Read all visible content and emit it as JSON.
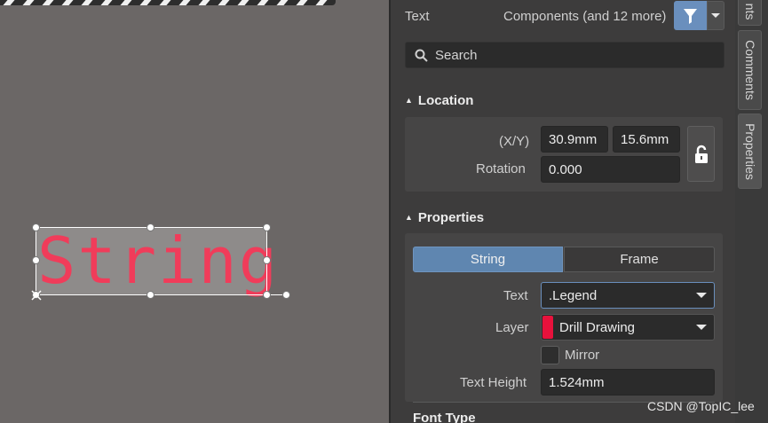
{
  "canvas": {
    "object_text": "String"
  },
  "panel": {
    "header_left": "Text",
    "header_filter": "Components (and 12 more)",
    "search_placeholder": "Search",
    "location": {
      "title": "Location",
      "xy_label": "(X/Y)",
      "x_value": "30.9mm",
      "y_value": "15.6mm",
      "rotation_label": "Rotation",
      "rotation_value": "0.000"
    },
    "properties": {
      "title": "Properties",
      "tab_string": "String",
      "tab_frame": "Frame",
      "text_label": "Text",
      "text_value": ".Legend",
      "layer_label": "Layer",
      "layer_value": "Drill Drawing",
      "layer_color": "#e8123c",
      "mirror_label": "Mirror",
      "text_height_label": "Text Height",
      "text_height_value": "1.524mm",
      "font_type_label": "Font Type"
    }
  },
  "side_tabs": {
    "tab1": "nts",
    "tab2": "Comments",
    "tab3": "Properties"
  },
  "watermark": "CSDN @TopIC_lee",
  "colors": {
    "accent": "#6a8fbd",
    "text_object": "#f03c5a"
  }
}
